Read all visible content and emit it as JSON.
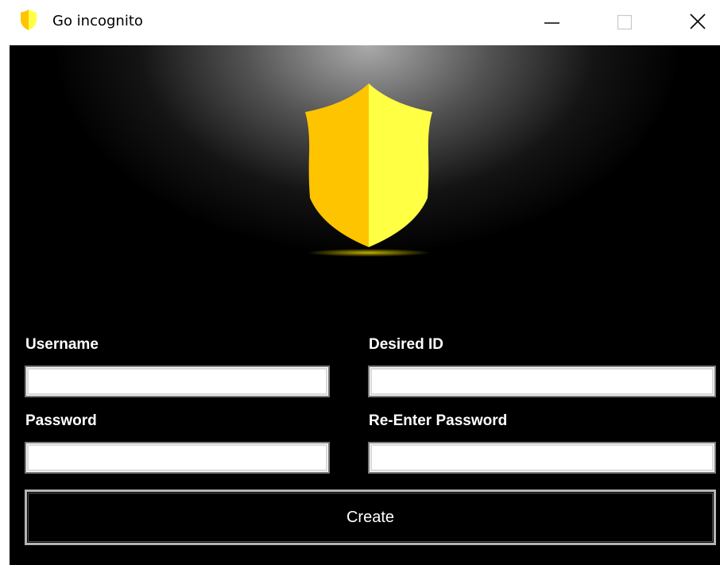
{
  "window": {
    "title": "Go incognito",
    "icon": "shield-icon",
    "controls": [
      "minimize-icon",
      "maximize-icon",
      "close-icon"
    ]
  },
  "form": {
    "username_label": "Username",
    "username_value": "",
    "desired_id_label": "Desired ID",
    "desired_id_value": "",
    "password_label": "Password",
    "password_value": "",
    "reenter_password_label": "Re-Enter Password",
    "reenter_password_value": "",
    "create_label": "Create"
  },
  "colors": {
    "background": "#000000",
    "shield_left": "#ffc400",
    "shield_right": "#ffff44",
    "text": "#ffffff"
  }
}
